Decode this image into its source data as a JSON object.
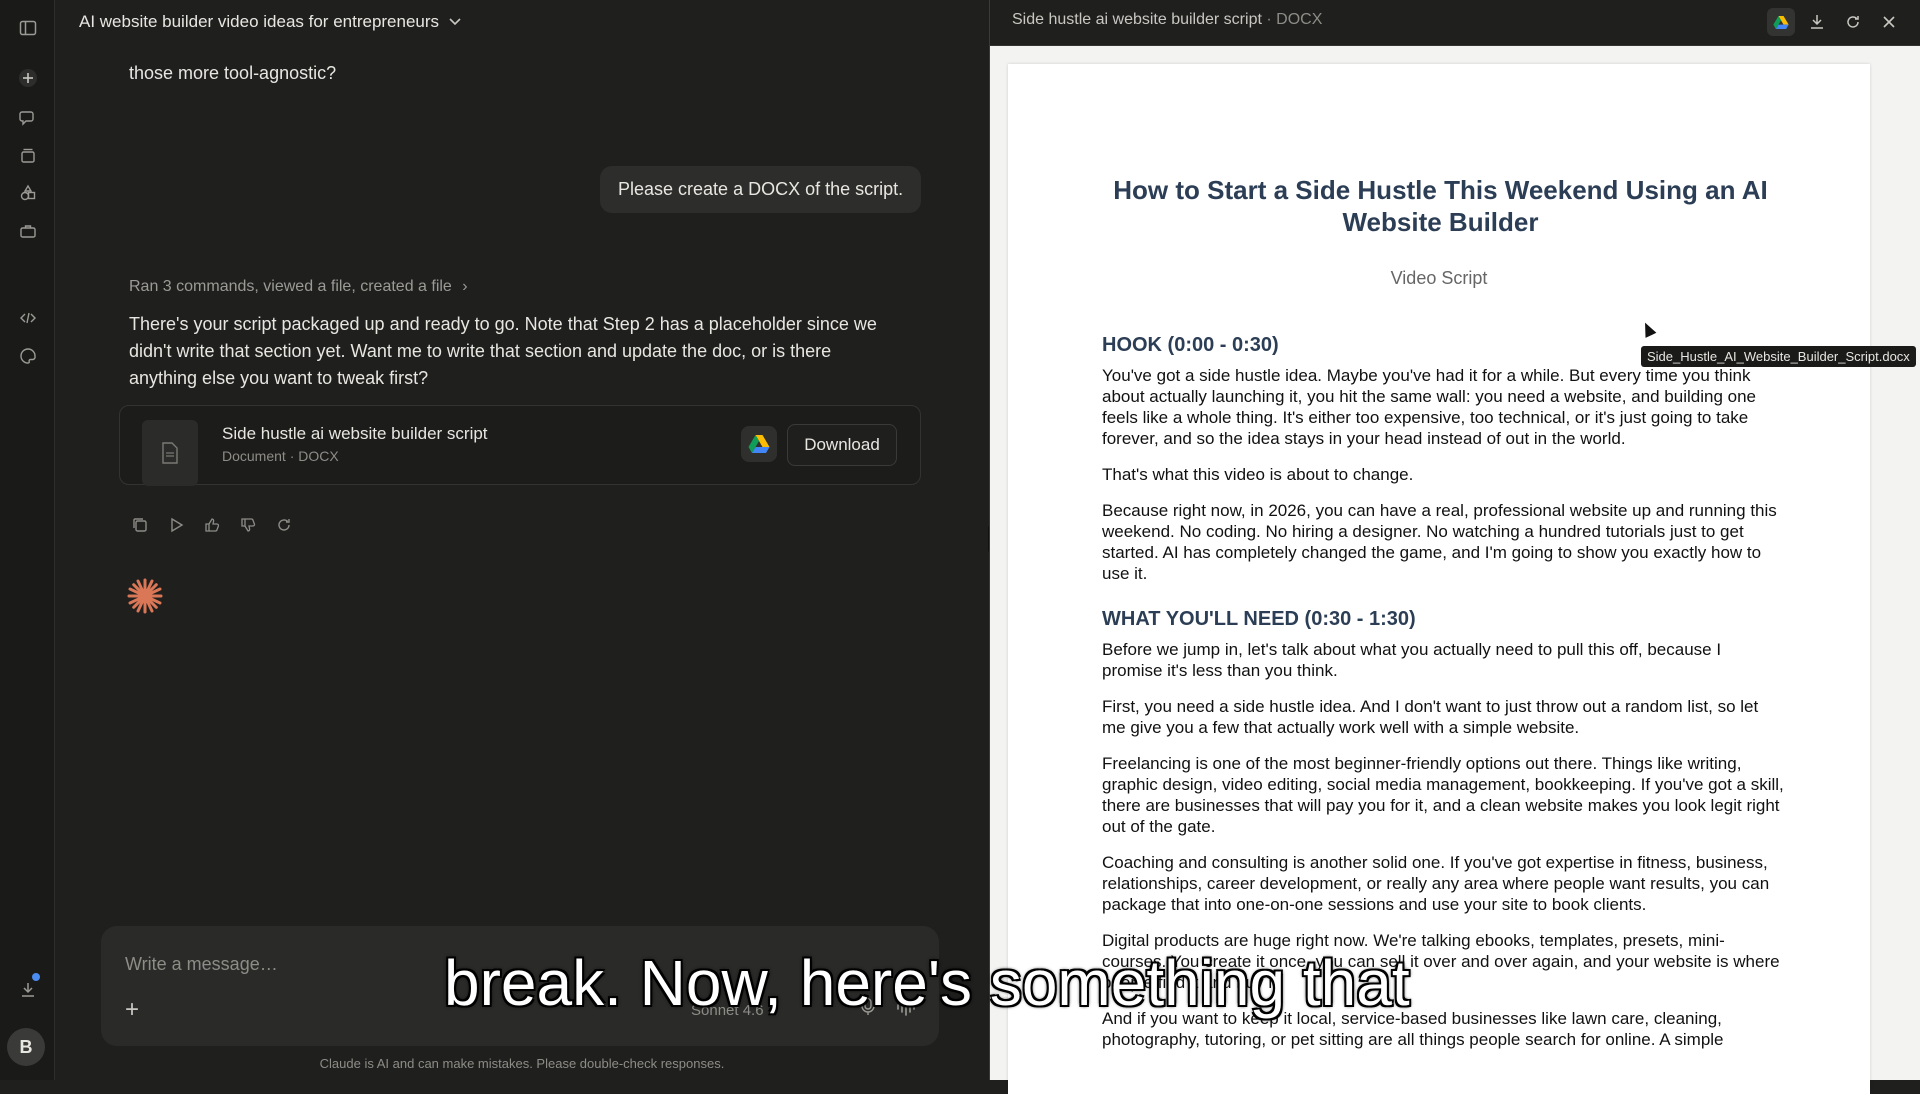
{
  "chat": {
    "title": "AI website builder video ideas for entrepreneurs",
    "faded_previous_text": "those more tool-agnostic?",
    "user_message": "Please create a DOCX of the script.",
    "activity_summary": "Ran 3 commands, viewed a file, created a file",
    "assistant_reply": "There's your script packaged up and ready to go. Note that Step 2 has a placeholder since we didn't write that section yet. Want me to write that section and update the doc, or is there anything else you want to tweak first?",
    "file_card": {
      "name": "Side hustle ai website builder script",
      "meta": "Document · DOCX",
      "download_label": "Download"
    },
    "composer": {
      "placeholder": "Write a message…",
      "model_label": "Sonnet 4.6"
    },
    "disclaimer": "Claude is AI and can make mistakes. Please double-check responses."
  },
  "user": {
    "avatar_initial": "B"
  },
  "doc_panel": {
    "title": "Side hustle ai website builder script",
    "type": "· DOCX",
    "tooltip": "Side_Hustle_AI_Website_Builder_Script.docx"
  },
  "document": {
    "title": "How to Start a Side Hustle This Weekend Using an AI Website Builder",
    "subtitle": "Video Script",
    "section1_heading": "HOOK (0:00 - 0:30)",
    "p1": "You've got a side hustle idea. Maybe you've had it for a while. But every time you think about actually launching it, you hit the same wall: you need a website, and building one feels like a whole thing. It's either too expensive, too technical, or it's just going to take forever, and so the idea stays in your head instead of out in the world.",
    "p2": "That's what this video is about to change.",
    "p3": "Because right now, in 2026, you can have a real, professional website up and running this weekend. No coding. No hiring a designer. No watching a hundred tutorials just to get started. AI has completely changed the game, and I'm going to show you exactly how to use it.",
    "section2_heading": "WHAT YOU'LL NEED (0:30 - 1:30)",
    "p4": "Before we jump in, let's talk about what you actually need to pull this off, because I promise it's less than you think.",
    "p5": "First, you need a side hustle idea. And I don't want to just throw out a random list, so let me give you a few that actually work well with a simple website.",
    "p6": "Freelancing is one of the most beginner-friendly options out there. Things like writing, graphic design, video editing, social media management, bookkeeping. If you've got a skill, there are businesses that will pay you for it, and a clean website makes you look legit right out of the gate.",
    "p7": "Coaching and consulting is another solid one. If you've got expertise in fitness, business, relationships, career development, or really any area where people want results, you can package that into one-on-one sessions and use your site to book clients.",
    "p8": "Digital products are huge right now. We're talking ebooks, templates, presets, mini-courses. You create it once, you can sell it over and over again, and your website is where people find it and buy it.",
    "p9": "And if you want to keep it local, service-based businesses like lawn care, cleaning, photography, tutoring, or pet sitting are all things people search for online. A simple"
  },
  "caption": "break. Now, here's something that",
  "icons": {
    "sidebar_toggle": "sidebar-toggle-icon",
    "new_chat": "plus-icon",
    "chats": "chat-icon",
    "projects": "stack-icon",
    "artifacts": "shapes-icon",
    "toolbox": "briefcase-icon",
    "code": "code-icon",
    "palette": "palette-icon",
    "downloads": "download-icon"
  },
  "colors": {
    "accent_spark": "#d97757",
    "doc_heading": "#2c3e55",
    "notification_dot": "#4a8cf0"
  }
}
